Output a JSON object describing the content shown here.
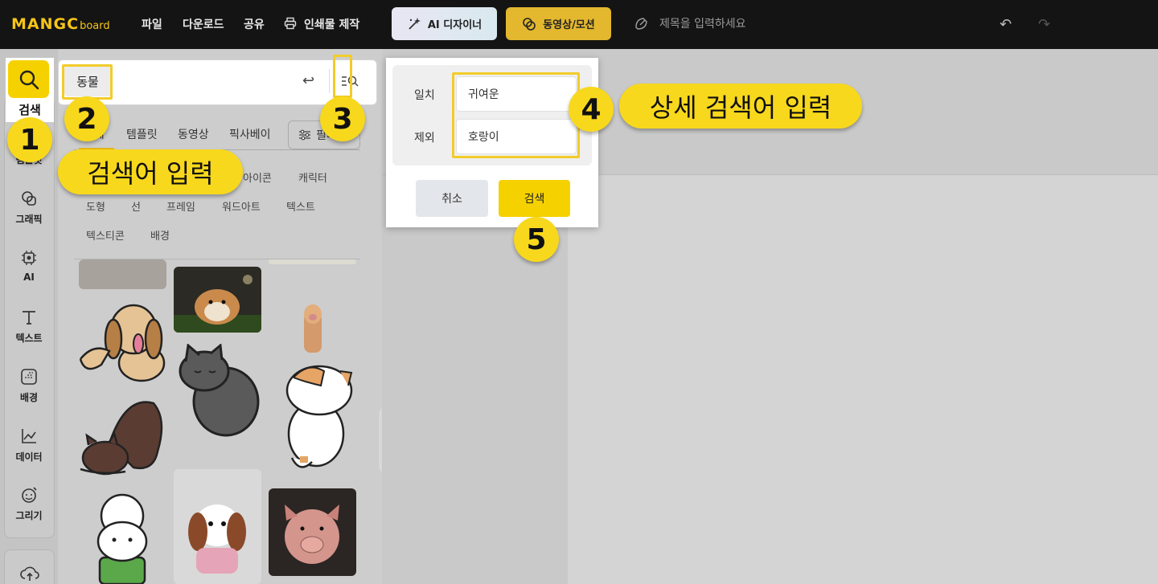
{
  "topbar": {
    "logo_main": "MANGC",
    "logo_sub": "board",
    "menu": [
      "파일",
      "다운로드",
      "공유"
    ],
    "print_label": "인쇄물 제작",
    "ai_designer_label": "AI 디자이너",
    "motion_label": "동영상/모션",
    "title_placeholder": "제목을 입력하세요",
    "icons": [
      "print-icon",
      "magic-wand-icon",
      "motion-icon",
      "pencil-icon",
      "undo-icon",
      "redo-icon"
    ]
  },
  "sidebar": {
    "search_label": "검색",
    "items": [
      {
        "label": "템플릿",
        "icon": "template-icon"
      },
      {
        "label": "그래픽",
        "icon": "graphic-icon"
      },
      {
        "label": "AI",
        "icon": "ai-chip-icon"
      },
      {
        "label": "텍스트",
        "icon": "text-icon"
      },
      {
        "label": "배경",
        "icon": "background-icon"
      },
      {
        "label": "데이터",
        "icon": "chart-icon"
      },
      {
        "label": "그리기",
        "icon": "draw-icon"
      }
    ]
  },
  "search": {
    "query_tag": "동물",
    "tabs": [
      "전체",
      "템플릿",
      "동영상",
      "픽사베이"
    ],
    "filter_label": "필터",
    "categories_row1": [
      "아이콘",
      "캐릭터"
    ],
    "categories_row2": [
      "도형",
      "선",
      "프레임",
      "워드아트",
      "텍스트"
    ],
    "categories_row3": [
      "텍스티콘",
      "배경"
    ]
  },
  "detail_search": {
    "match_label": "일치",
    "match_value": "귀여운",
    "exclude_label": "제외",
    "exclude_value": "호랑이",
    "cancel_label": "취소",
    "search_label": "검색"
  },
  "annotations": {
    "n1": "1",
    "n2": "2",
    "n3": "3",
    "n4": "4",
    "n5": "5",
    "callout_search_input": "검색어 입력",
    "callout_detail_input": "상세 검색어 입력"
  },
  "colors": {
    "accent": "#f6d100",
    "topbar": "#141414",
    "highlight_border": "#f2cc2a"
  }
}
